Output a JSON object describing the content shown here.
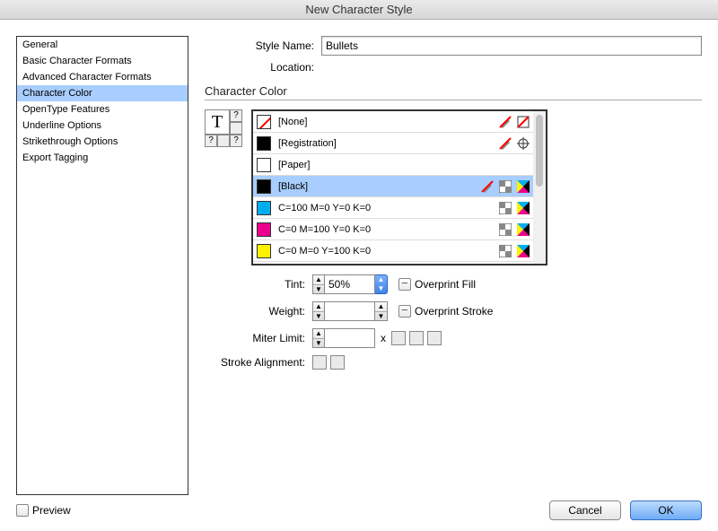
{
  "title": "New Character Style",
  "sidebar": {
    "items": [
      {
        "label": "General"
      },
      {
        "label": "Basic Character Formats"
      },
      {
        "label": "Advanced Character Formats"
      },
      {
        "label": "Character Color"
      },
      {
        "label": "OpenType Features"
      },
      {
        "label": "Underline Options"
      },
      {
        "label": "Strikethrough Options"
      },
      {
        "label": "Export Tagging"
      }
    ],
    "selected_index": 3
  },
  "form": {
    "style_name_label": "Style Name:",
    "style_name_value": "Bullets",
    "location_label": "Location:",
    "location_value": ""
  },
  "section_title": "Character Color",
  "swatches": [
    {
      "name": "[None]",
      "fill": "none",
      "icons": [
        "nopencil",
        "none"
      ]
    },
    {
      "name": "[Registration]",
      "fill": "#000000",
      "icons": [
        "nopencil",
        "registration"
      ]
    },
    {
      "name": "[Paper]",
      "fill": "#ffffff",
      "icons": []
    },
    {
      "name": "[Black]",
      "fill": "#000000",
      "icons": [
        "nopencil",
        "checker",
        "cmyk"
      ],
      "selected": true
    },
    {
      "name": "C=100 M=0 Y=0 K=0",
      "fill": "#00aeef",
      "icons": [
        "checker",
        "cmyk"
      ]
    },
    {
      "name": "C=0 M=100 Y=0 K=0",
      "fill": "#ec008c",
      "icons": [
        "checker",
        "cmyk"
      ]
    },
    {
      "name": "C=0 M=0 Y=100 K=0",
      "fill": "#fff200",
      "icons": [
        "checker",
        "cmyk"
      ]
    }
  ],
  "controls": {
    "tint_label": "Tint:",
    "tint_value": "50%",
    "overprint_fill_label": "Overprint Fill",
    "weight_label": "Weight:",
    "weight_value": "",
    "overprint_stroke_label": "Overprint Stroke",
    "miter_label": "Miter Limit:",
    "miter_value": "",
    "miter_x": "x",
    "stroke_align_label": "Stroke Alignment:"
  },
  "footer": {
    "preview_label": "Preview",
    "cancel_label": "Cancel",
    "ok_label": "OK"
  }
}
